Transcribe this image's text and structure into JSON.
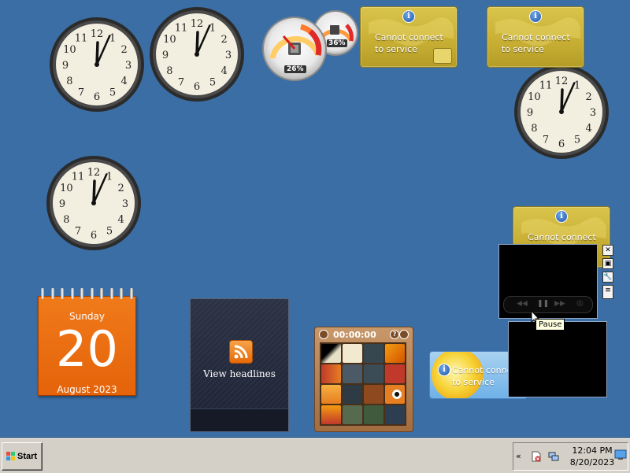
{
  "desktop": {
    "background": "#3a6ea5"
  },
  "clocks": [
    {
      "id": "clock-1",
      "hour": 12,
      "minute": 4
    },
    {
      "id": "clock-2",
      "hour": 12,
      "minute": 4
    },
    {
      "id": "clock-3",
      "hour": 12,
      "minute": 4
    },
    {
      "id": "clock-4",
      "hour": 12,
      "minute": 4
    }
  ],
  "cpu_meter": {
    "cpu_percent": "26%",
    "memory_percent": "36%"
  },
  "currency_gadgets": [
    {
      "message_line1": "Cannot connect",
      "message_line2": "to service"
    },
    {
      "message_line1": "Cannot connect",
      "message_line2": "to service"
    },
    {
      "message_line1": "Cannot connect",
      "message_line2": ""
    }
  ],
  "calendar": {
    "day_of_week": "Sunday",
    "day": "20",
    "month_year": "August 2023"
  },
  "feed": {
    "label": "View headlines"
  },
  "puzzle": {
    "timer": "00:00:00",
    "help": "?"
  },
  "weather": {
    "message_line1": "Cannot connect",
    "message_line2": "to service"
  },
  "media": {
    "tooltip": "Pause"
  },
  "taskbar": {
    "start_label": "Start",
    "time": "12:04 PM",
    "date": "8/20/2023",
    "chevron": "«"
  },
  "colors": {
    "calendar": "#e5630a",
    "currency": "#c9b035",
    "weather": "#6fb1e8"
  }
}
